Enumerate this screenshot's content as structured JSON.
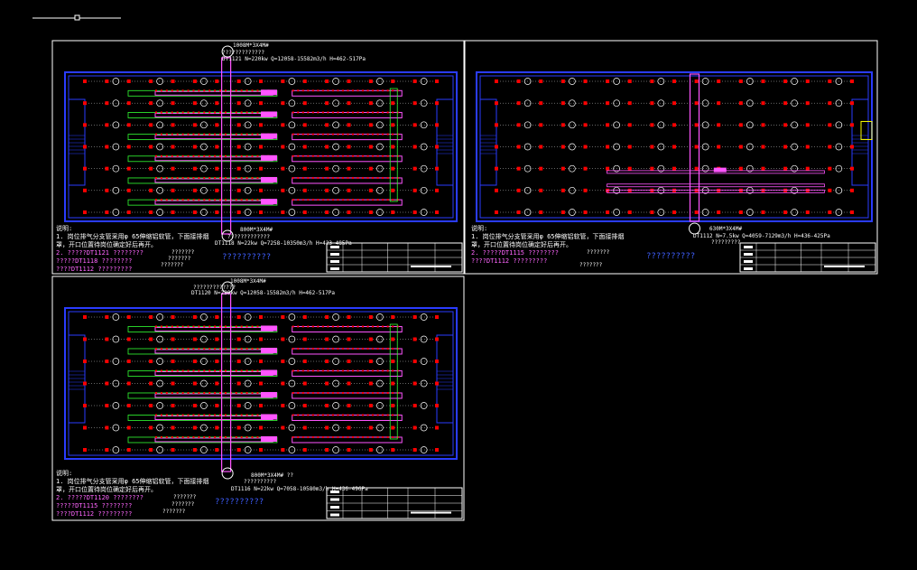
{
  "sheets": [
    {
      "id": "s1",
      "top_label": "1008M*3X4M#",
      "top_spec_a": "?????????????",
      "top_spec_b": "DT1121 N=220kw Q=12058-15582m3/h H=462-517Pa",
      "bot_label": "800M*3X4M#",
      "bot_spec_a": "?????????????",
      "bot_spec_b": "DT1118 N=22kw Q=7258-10350m3/h H=423-485Pa",
      "notes_title": "说明:",
      "note_1": "1. 岗位排气分支管采用φ 65伸缩铝软管，下面接排烟",
      "note_1b": "罩，开口位置待岗位确定好后再开。",
      "note_2a": "2. ?????DT1121 ????????",
      "note_2b": "?????DT1118 ????????",
      "note_2c": "????DT1112 ?????????",
      "legend_a": "???????",
      "legend_b": "???????",
      "legend_c": "???????",
      "dash": "??????????"
    },
    {
      "id": "s2",
      "bot_label": "630M*3X4M#",
      "bot_spec_a": "DT1112 N=7.5kw Q=4059-7129m3/h H=436-425Pa",
      "bot_spec_b": "?????????",
      "notes_title": "说明:",
      "note_1": "1. 岗位排气分支管采用φ 65伸缩铝软管，下面接排烟",
      "note_1b": "罩，开口位置待岗位确定好后再开。",
      "note_2a": "2. ?????DT1115 ????????",
      "note_2b": "????DT1112 ?????????",
      "legend_a": "???????",
      "legend_b": "???????",
      "dash": "??????????"
    },
    {
      "id": "s3",
      "top_label": "1008M*3X4M#",
      "top_spec_a": "?????????????",
      "top_spec_b": "DT1120 N=220kw Q=12058-15582m3/h H=462-517Pa",
      "bot_label": "800M*3X4M# ??",
      "bot_spec_a": "??????????",
      "bot_spec_b": "DT1116 N=22kw Q=7058-10580m3/h H=436-496Pa",
      "notes_title": "说明:",
      "note_1": "1. 岗位排气分支管采用φ 65伸缩铝软管，下面接排烟",
      "note_1b": "罩，开口位置待岗位确定好后再开。",
      "note_2a": "2. ?????DT1120 ????????",
      "note_2b": "?????DT1115 ????????",
      "note_2c": "????DT1112 ?????????",
      "legend_a": "???????",
      "legend_b": "???????",
      "legend_c": "???????",
      "dash": "??????????"
    }
  ],
  "colors": {
    "background": "#000000",
    "frame": "#ffffff",
    "wall": "#2a3cff",
    "column": "#ff0000",
    "duct_magenta": "#ff55ff",
    "duct_green": "#33ff33",
    "duct_cyan": "#33ffff",
    "text": "#ffffff"
  }
}
